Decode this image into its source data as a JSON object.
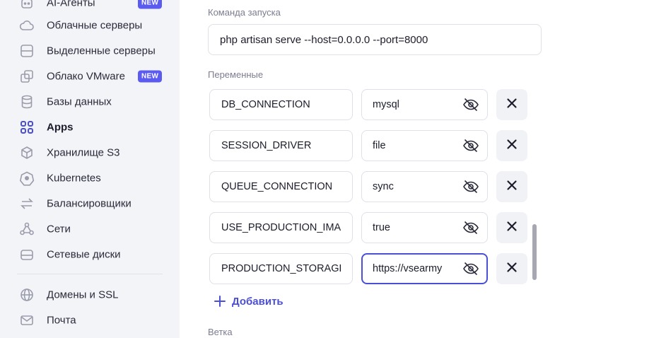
{
  "sidebar": {
    "items": [
      {
        "label": "AI-Агенты",
        "icon": "robot-icon",
        "badge": "NEW"
      },
      {
        "label": "Облачные серверы",
        "icon": "cloud-icon"
      },
      {
        "label": "Выделенные серверы",
        "icon": "server-icon"
      },
      {
        "label": "Облако VMware",
        "icon": "vmware-icon",
        "badge": "NEW"
      },
      {
        "label": "Базы данных",
        "icon": "database-icon"
      },
      {
        "label": "Apps",
        "icon": "apps-grid-icon",
        "active": true
      },
      {
        "label": "Хранилище S3",
        "icon": "cube-icon"
      },
      {
        "label": "Kubernetes",
        "icon": "kubernetes-icon"
      },
      {
        "label": "Балансировщики",
        "icon": "arrows-swap-icon"
      },
      {
        "label": "Сети",
        "icon": "network-icon"
      },
      {
        "label": "Сетевые диски",
        "icon": "disk-icon"
      },
      {
        "label": "Домены и SSL",
        "icon": "globe-icon"
      },
      {
        "label": "Почта",
        "icon": "mail-icon"
      }
    ]
  },
  "form": {
    "command_label": "Команда запуска",
    "command_value": "php artisan serve --host=0.0.0.0 --port=8000",
    "variables_label": "Переменные",
    "variables": [
      {
        "key": "DB_CONNECTION",
        "value": "mysql"
      },
      {
        "key": "SESSION_DRIVER",
        "value": "file"
      },
      {
        "key": "QUEUE_CONNECTION",
        "value": "sync"
      },
      {
        "key": "USE_PRODUCTION_IMAGES",
        "value": "true"
      },
      {
        "key": "PRODUCTION_STORAGE_URL",
        "value": "https://vsearmy"
      }
    ],
    "add_label": "Добавить",
    "branch_label": "Ветка"
  },
  "colors": {
    "accent": "#4b4fd8",
    "badge": "#5b5bf0",
    "sidebar_bg": "#f3f4f8"
  }
}
